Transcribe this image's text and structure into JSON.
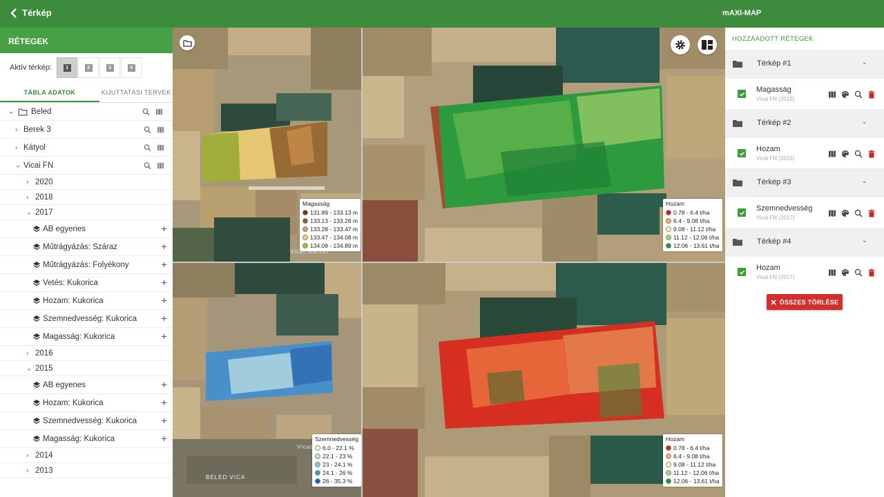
{
  "topbar": {
    "back_label": "Térkép",
    "app_title": "mAXI-MAP",
    "color": "#3d8b3d"
  },
  "left": {
    "header": "RÉTEGEK",
    "map_selector_label": "Aktív térkép:",
    "map_buttons": [
      "1",
      "2",
      "3",
      "4"
    ],
    "active_map": "1",
    "tabs": [
      "TÁBLA ADATOK",
      "KIJUTTATÁSI TERVEK"
    ],
    "tree": {
      "root": "Beled",
      "farms": [
        "Berek 3",
        "Kátyol",
        "Vicai FN"
      ],
      "years": {
        "y2020": "2020",
        "y2018": "2018",
        "y2017": "2017",
        "y2016": "2016",
        "y2015": "2015",
        "y2014": "2014",
        "y2013": "2013"
      },
      "layers2017": [
        "AB egyenes",
        "Műtrágyázás: Száraz",
        "Műtrágyázás: Folyékony",
        "Vetés: Kukorica",
        "Hozam: Kukorica",
        "Szemnedvesség: Kukorica",
        "Magasság: Kukorica"
      ],
      "layers2015": [
        "AB egyenes",
        "Hozam: Kukorica",
        "Szemnedvesség: Kukorica",
        "Magasság: Kukorica"
      ]
    }
  },
  "maps": {
    "town_label": "Vicai Market",
    "town_label2": "Vicai Market B",
    "place_label": "BELED VICA",
    "legend1": {
      "title": "Magasság",
      "items": [
        "131.89 - 133.13 m",
        "133.13 - 133.28 m",
        "133.28 - 133.47 m",
        "133.47 - 134.08 m",
        "134.08 - 134.89 m"
      ],
      "colors": [
        "#6b3a1e",
        "#a0522d",
        "#e0955a",
        "#f0d070",
        "#a8b838"
      ]
    },
    "legend2": {
      "title": "Hozam",
      "items": [
        "0.78 - 6.4 t/ha",
        "6.4 - 9.08 t/ha",
        "9.08 - 11.12 t/ha",
        "11.12 - 12.06 t/ha",
        "12.06 - 13.61 t/ha"
      ],
      "colors": [
        "#d7191c",
        "#fdae61",
        "#ffffbf",
        "#a6d96a",
        "#1a9641"
      ]
    },
    "legend3": {
      "title": "Szemnedvesség",
      "items": [
        "6.0 - 22.1 %",
        "22.1 - 23 %",
        "23 - 24.1 %",
        "24.1 - 26 %",
        "26 - 35.3 %"
      ],
      "colors": [
        "#ffffd9",
        "#c7e9b4",
        "#7fcdbb",
        "#2c9fc7",
        "#1d5fa8"
      ]
    },
    "legend4": {
      "title": "Hozam",
      "items": [
        "0.78 - 6.4 t/ha",
        "6.4 - 9.08 t/ha",
        "9.08 - 11.12 t/ha",
        "11.12 - 12.06 t/ha",
        "12.06 - 13.61 t/ha"
      ],
      "colors": [
        "#d7191c",
        "#fdae61",
        "#ffffbf",
        "#a6d96a",
        "#1a9641"
      ]
    }
  },
  "right": {
    "header": "HOZZÁADOTT RÉTEGEK",
    "groups": [
      {
        "name": "Térkép #1",
        "item": "Magasság",
        "sub": "Vicai FN (2018)"
      },
      {
        "name": "Térkép #2",
        "item": "Hozam",
        "sub": "Vicai FN (2016)"
      },
      {
        "name": "Térkép #3",
        "item": "Szemnedvesség",
        "sub": "Vicai FN (2017)"
      },
      {
        "name": "Térkép #4",
        "item": "Hozam",
        "sub": "Vicai FN (2017)"
      }
    ],
    "clear_all": "ÖSSZES TÖRLÉSE",
    "accent": "#3d9b3d",
    "danger": "#d32f2f"
  }
}
